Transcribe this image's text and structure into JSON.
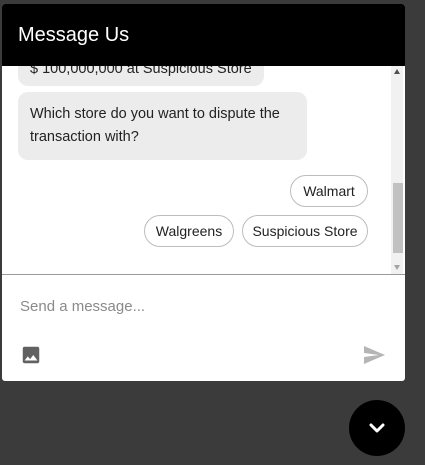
{
  "header": {
    "title": "Message Us"
  },
  "messages": {
    "previous": "$ 100,000,000 at Suspicious Store",
    "question": "Which store do you want to dispute the transaction with?"
  },
  "quick_replies": [
    "Walmart",
    "Walgreens",
    "Suspicious Store"
  ],
  "composer": {
    "placeholder": "Send a message...",
    "image_icon": "image-icon",
    "send_icon": "send-icon"
  },
  "fab": {
    "icon": "chevron-down-icon"
  },
  "colors": {
    "header_bg": "#000000",
    "bubble_bg": "#ececec",
    "page_bg": "#3b3b3b"
  }
}
